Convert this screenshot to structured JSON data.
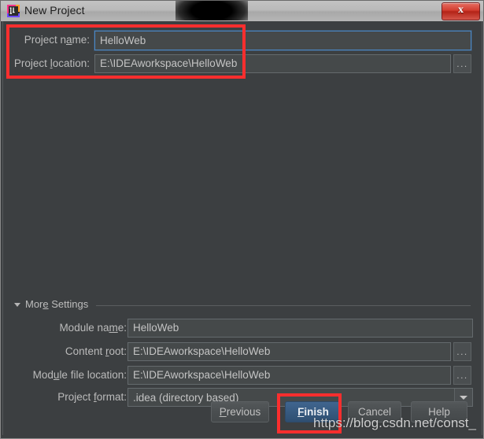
{
  "window": {
    "title": "New Project",
    "app_icon": "intellij-idea-icon",
    "close_label": "x"
  },
  "top_form": {
    "project_name": {
      "label_prefix": "Project n",
      "label_mnemonic": "a",
      "label_suffix": "me:",
      "value": "HelloWeb"
    },
    "project_location": {
      "label_prefix": "Project ",
      "label_mnemonic": "l",
      "label_suffix": "ocation:",
      "value": "E:\\IDEAworkspace\\HelloWeb",
      "browse_label": "..."
    }
  },
  "more_settings": {
    "title_prefix": "Mor",
    "title_mnemonic": "e",
    "title_suffix": " Settings",
    "expanded": true,
    "caret_icon": "chevron-down-icon",
    "fields": [
      {
        "name": "module-name",
        "label_prefix": "Module na",
        "label_mnemonic": "m",
        "label_suffix": "e:",
        "value": "HelloWeb",
        "has_browse": false
      },
      {
        "name": "content-root",
        "label_prefix": "Content ",
        "label_mnemonic": "r",
        "label_suffix": "oot:",
        "value": "E:\\IDEAworkspace\\HelloWeb",
        "has_browse": true,
        "browse_label": "..."
      },
      {
        "name": "module-file-location",
        "label_prefix": "Mod",
        "label_mnemonic": "u",
        "label_suffix": "le file location:",
        "value": "E:\\IDEAworkspace\\HelloWeb",
        "has_browse": true,
        "browse_label": "..."
      }
    ],
    "project_format": {
      "label_prefix": "Project ",
      "label_mnemonic": "f",
      "label_suffix": "ormat:",
      "value": ".idea (directory based)",
      "arrow_icon": "chevron-down-icon"
    }
  },
  "buttons": {
    "previous": {
      "prefix": "",
      "mnemonic": "P",
      "suffix": "revious"
    },
    "finish": {
      "prefix": "",
      "mnemonic": "F",
      "suffix": "inish",
      "is_default": true
    },
    "cancel": {
      "prefix": "Cancel",
      "mnemonic": "",
      "suffix": ""
    },
    "help": {
      "prefix": "Help",
      "mnemonic": "",
      "suffix": ""
    }
  },
  "annotations": {
    "color": "#fb2e2e",
    "regions": [
      "top-fields-highlight",
      "finish-button-highlight"
    ]
  },
  "watermark": {
    "text": "https://blog.csdn.net/const_"
  }
}
